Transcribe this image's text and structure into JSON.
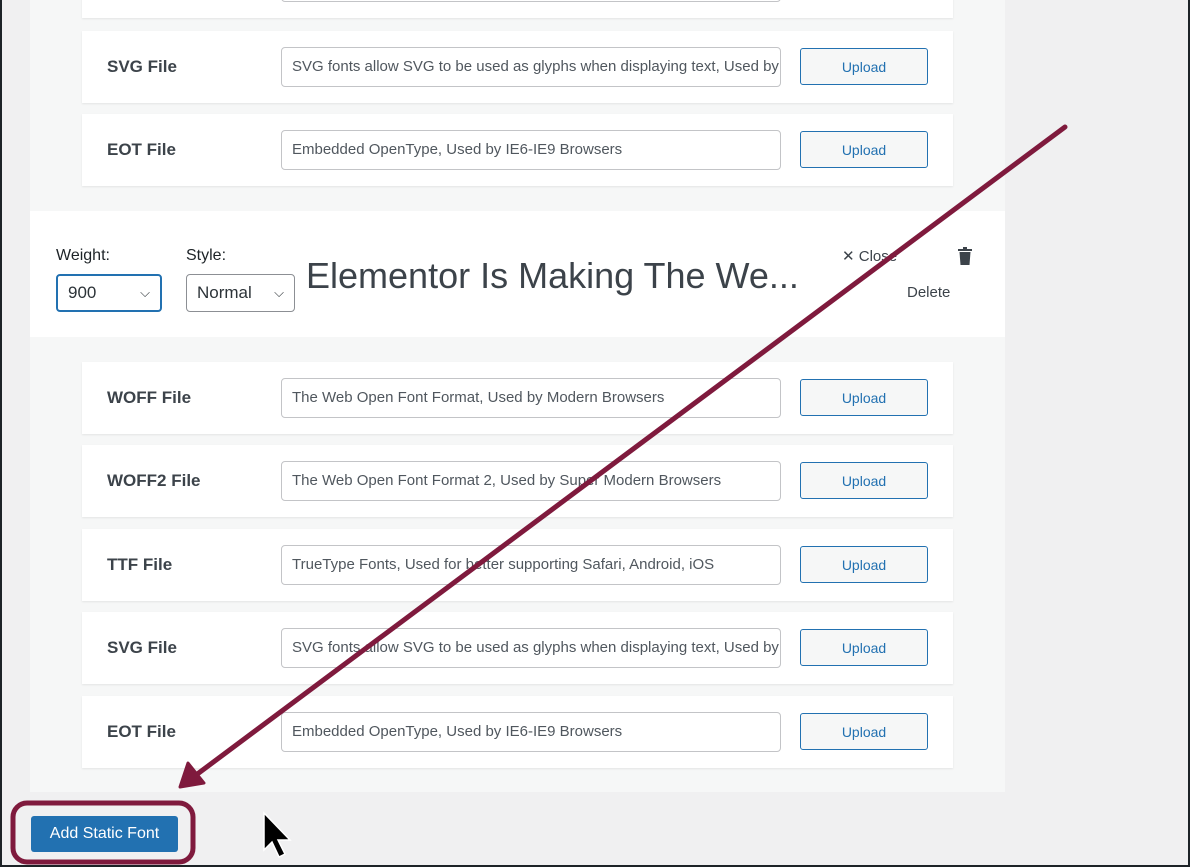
{
  "rows_top": [
    {
      "label": "SVG File",
      "placeholder": "SVG fonts allow SVG to be used as glyphs when displaying text, Used by iPhone",
      "button": "Upload"
    },
    {
      "label": "EOT File",
      "placeholder": "Embedded OpenType, Used by IE6-IE9 Browsers",
      "button": "Upload"
    }
  ],
  "variation": {
    "weight_label": "Weight:",
    "weight_value": "900",
    "style_label": "Style:",
    "style_value": "Normal",
    "preview_text": "Elementor Is Making The We...",
    "close_label": "Close",
    "delete_label": "Delete"
  },
  "rows_bottom": [
    {
      "label": "WOFF File",
      "placeholder": "The Web Open Font Format, Used by Modern Browsers",
      "button": "Upload"
    },
    {
      "label": "WOFF2 File",
      "placeholder": "The Web Open Font Format 2, Used by Super Modern Browsers",
      "button": "Upload"
    },
    {
      "label": "TTF File",
      "placeholder": "TrueType Fonts, Used for better supporting Safari, Android, iOS",
      "button": "Upload"
    },
    {
      "label": "SVG File",
      "placeholder": "SVG fonts allow SVG to be used as glyphs when displaying text, Used by iPhone",
      "button": "Upload"
    },
    {
      "label": "EOT File",
      "placeholder": "Embedded OpenType, Used by IE6-IE9 Browsers",
      "button": "Upload"
    }
  ],
  "add_button": "Add Static Font",
  "colors": {
    "accent": "#2271b1",
    "annotation": "#7f1a3d"
  }
}
